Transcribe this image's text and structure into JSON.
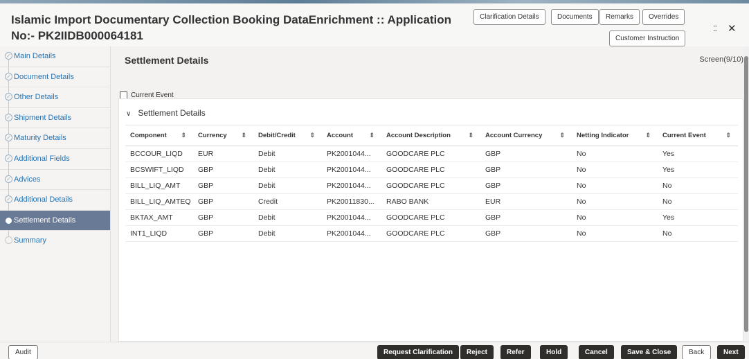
{
  "window": {
    "title": "Islamic Import Documentary Collection Booking DataEnrichment :: Application No:- PK2IIDB000064181",
    "minimize_glyph": "⁚⁚",
    "close_glyph": "✕"
  },
  "header_buttons": {
    "clarification": "Clarification Details",
    "documents": "Documents",
    "remarks": "Remarks",
    "overrides": "Overrides",
    "customer_instruction": "Customer Instruction"
  },
  "sidebar": {
    "items": [
      {
        "label": "Main Details",
        "state": "done"
      },
      {
        "label": "Document Details",
        "state": "done"
      },
      {
        "label": "Other Details",
        "state": "done"
      },
      {
        "label": "Shipment Details",
        "state": "done"
      },
      {
        "label": "Maturity Details",
        "state": "done"
      },
      {
        "label": "Additional Fields",
        "state": "done"
      },
      {
        "label": "Advices",
        "state": "done"
      },
      {
        "label": "Additional Details",
        "state": "done"
      },
      {
        "label": "Settlement Details",
        "state": "active"
      },
      {
        "label": "Summary",
        "state": "pending"
      }
    ]
  },
  "main": {
    "title": "Settlement Details",
    "screen": "Screen(9/10)",
    "current_event_label": "Current Event",
    "current_event_checked": false,
    "panel_title": "Settlement Details"
  },
  "table": {
    "headers": [
      "Component",
      "Currency",
      "Debit/Credit",
      "Account",
      "Account Description",
      "Account Currency",
      "Netting Indicator",
      "Current Event"
    ],
    "rows": [
      [
        "BCCOUR_LIQD",
        "EUR",
        "Debit",
        "PK2001044...",
        "GOODCARE PLC",
        "GBP",
        "No",
        "Yes"
      ],
      [
        "BCSWIFT_LIQD",
        "GBP",
        "Debit",
        "PK2001044...",
        "GOODCARE PLC",
        "GBP",
        "No",
        "Yes"
      ],
      [
        "BILL_LIQ_AMT",
        "GBP",
        "Debit",
        "PK2001044...",
        "GOODCARE PLC",
        "GBP",
        "No",
        "No"
      ],
      [
        "BILL_LIQ_AMTEQ",
        "GBP",
        "Credit",
        "PK20011830...",
        "RABO BANK",
        "EUR",
        "No",
        "No"
      ],
      [
        "BKTAX_AMT",
        "GBP",
        "Debit",
        "PK2001044...",
        "GOODCARE PLC",
        "GBP",
        "No",
        "Yes"
      ],
      [
        "INT1_LIQD",
        "GBP",
        "Debit",
        "PK2001044...",
        "GOODCARE PLC",
        "GBP",
        "No",
        "No"
      ]
    ]
  },
  "footer": {
    "audit": "Audit",
    "request_clarification": "Request Clarification",
    "reject": "Reject",
    "refer": "Refer",
    "hold": "Hold",
    "cancel": "Cancel",
    "save_close": "Save & Close",
    "back": "Back",
    "next": "Next"
  },
  "colors": {
    "accent": "#2773b3",
    "active_nav": "#687a96",
    "dark_button": "#2f2e2b"
  }
}
